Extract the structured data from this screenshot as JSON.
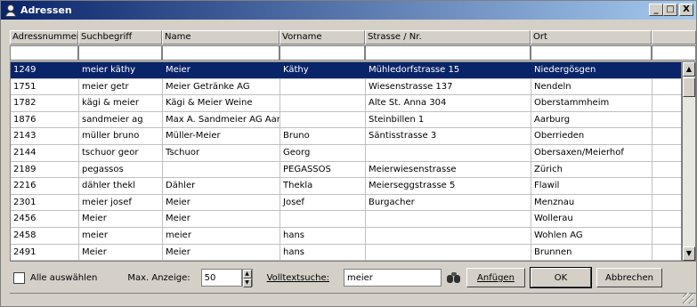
{
  "window": {
    "title": "Adressen",
    "minimize_label": "_",
    "maximize_label": "□",
    "close_label": "X"
  },
  "columns": [
    "Adressnummer",
    "Suchbegriff",
    "Name",
    "Vorname",
    "Strasse / Nr.",
    "Ort",
    ""
  ],
  "filters": [
    "",
    "",
    "",
    "",
    "",
    "",
    ""
  ],
  "rows": [
    [
      "1249",
      "meier käthy",
      "Meier",
      "Käthy",
      "Mühledorfstrasse 15",
      "Niedergösgen"
    ],
    [
      "1751",
      "meier getr",
      "Meier Getränke AG",
      "",
      "Wiesenstrasse 137",
      "Nendeln"
    ],
    [
      "1782",
      "kägi & meier",
      "Kägi & Meier Weine",
      "",
      "Alte St. Anna 304",
      "Oberstammheim"
    ],
    [
      "1876",
      "sandmeier ag",
      "Max A. Sandmeier AG Aar",
      "",
      "Steinbillen 1",
      "Aarburg"
    ],
    [
      "2143",
      "müller bruno",
      "Müller-Meier",
      "Bruno",
      "Säntisstrasse 3",
      "Oberrieden"
    ],
    [
      "2144",
      "tschuor geor",
      "Tschuor",
      "Georg",
      "",
      "Obersaxen/Meierhof"
    ],
    [
      "2189",
      "pegassos",
      "",
      "PEGASSOS",
      "Meierwiesenstrasse",
      "Zürich"
    ],
    [
      "2216",
      "dähler thekl",
      "Dähler",
      "Thekla",
      "Meierseggstrasse 5",
      "Flawil"
    ],
    [
      "2301",
      "meier josef",
      "Meier",
      "Josef",
      "Burgacher",
      "Menznau"
    ],
    [
      "2456",
      "Meier",
      "Meier",
      "",
      "",
      "Wollerau"
    ],
    [
      "2458",
      "meier",
      "meier",
      "hans",
      "",
      "Wohlen AG"
    ],
    [
      "2491",
      "Meier",
      "Meier",
      "hans",
      "",
      "Brunnen"
    ]
  ],
  "selected_row": 0,
  "bottom": {
    "select_all_label": "Alle auswählen",
    "max_label": "Max. Anzeige:",
    "max_value": "50",
    "fulltext_label": "Volltextsuche:",
    "fulltext_value": "meier",
    "append_label": "Anfügen",
    "ok_label": "OK",
    "cancel_label": "Abbrechen"
  },
  "colors": {
    "selection": "#0a246a",
    "title_start": "#0a246a",
    "title_end": "#a6caf0"
  }
}
